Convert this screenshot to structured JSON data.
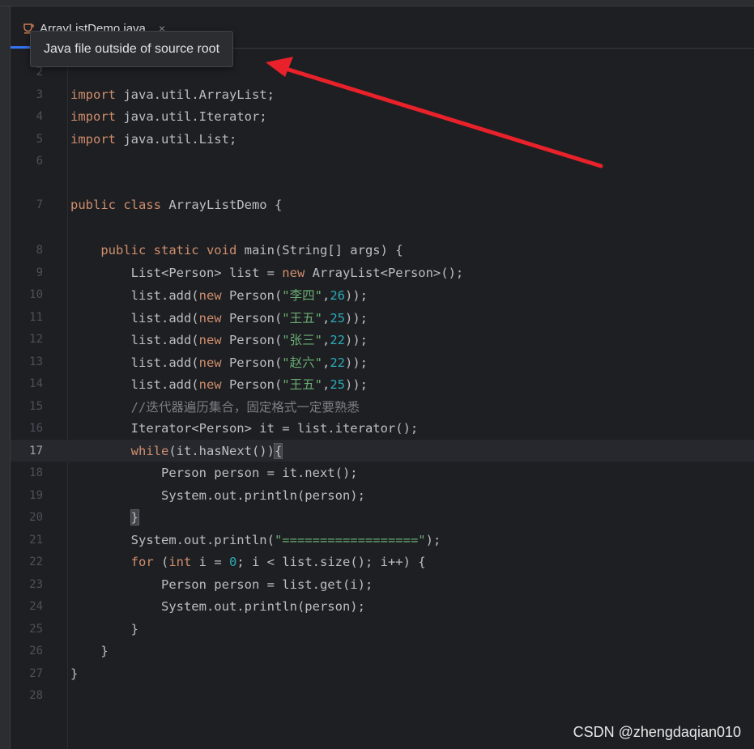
{
  "tab": {
    "filename": "ArrayListDemo.java",
    "close_glyph": "×",
    "icon": "java-file-icon"
  },
  "tooltip": {
    "text": "Java file outside of source root"
  },
  "watermark": {
    "text": "CSDN @zhengdaqian010"
  },
  "colors": {
    "accent": "#3574f0",
    "arrow": "#e8212a",
    "keyword": "#cf8e6d",
    "string": "#6aab73",
    "number": "#2aacb8"
  },
  "current_line": "17",
  "lines": [
    {
      "n": "2",
      "tokens": []
    },
    {
      "n": "3",
      "tokens": [
        [
          "kw",
          "import"
        ],
        [
          "",
          "java.util.ArrayList;"
        ]
      ]
    },
    {
      "n": "4",
      "tokens": [
        [
          "kw",
          "import"
        ],
        [
          "",
          "java.util.Iterator;"
        ]
      ]
    },
    {
      "n": "5",
      "tokens": [
        [
          "kw",
          "import"
        ],
        [
          "",
          "java.util.List;"
        ]
      ]
    },
    {
      "n": "6",
      "tokens": []
    },
    {
      "n": "7",
      "tokens": [
        [
          "kw",
          "public class"
        ],
        [
          "",
          "ArrayListDemo {"
        ]
      ]
    },
    {
      "n": "8",
      "tokens": [
        [
          "",
          "    "
        ],
        [
          "kw",
          "public static void"
        ],
        [
          "",
          "main(String[] args) {"
        ]
      ]
    },
    {
      "n": "9",
      "tokens": [
        [
          "",
          "        List<Person> list = "
        ],
        [
          "kw",
          "new"
        ],
        [
          "",
          " ArrayList<Person>();"
        ]
      ]
    },
    {
      "n": "10",
      "tokens": [
        [
          "",
          "        list.add("
        ],
        [
          "kw",
          "new"
        ],
        [
          "",
          " Person("
        ],
        [
          "str",
          "\"李四\""
        ],
        [
          "",
          ","
        ],
        [
          "num",
          "26"
        ],
        [
          "",
          "));"
        ]
      ]
    },
    {
      "n": "11",
      "tokens": [
        [
          "",
          "        list.add("
        ],
        [
          "kw",
          "new"
        ],
        [
          "",
          " Person("
        ],
        [
          "str",
          "\"王五\""
        ],
        [
          "",
          ","
        ],
        [
          "num",
          "25"
        ],
        [
          "",
          "));"
        ]
      ]
    },
    {
      "n": "12",
      "tokens": [
        [
          "",
          "        list.add("
        ],
        [
          "kw",
          "new"
        ],
        [
          "",
          " Person("
        ],
        [
          "str",
          "\"张三\""
        ],
        [
          "",
          ","
        ],
        [
          "num",
          "22"
        ],
        [
          "",
          "));"
        ]
      ]
    },
    {
      "n": "13",
      "tokens": [
        [
          "",
          "        list.add("
        ],
        [
          "kw",
          "new"
        ],
        [
          "",
          " Person("
        ],
        [
          "str",
          "\"赵六\""
        ],
        [
          "",
          ","
        ],
        [
          "num",
          "22"
        ],
        [
          "",
          "));"
        ]
      ]
    },
    {
      "n": "14",
      "tokens": [
        [
          "",
          "        list.add("
        ],
        [
          "kw",
          "new"
        ],
        [
          "",
          " Person("
        ],
        [
          "str",
          "\"王五\""
        ],
        [
          "",
          ","
        ],
        [
          "num",
          "25"
        ],
        [
          "",
          "));"
        ]
      ]
    },
    {
      "n": "15",
      "tokens": [
        [
          "",
          "        "
        ],
        [
          "cmt",
          "//迭代器遍历集合，固定格式一定要熟悉"
        ]
      ]
    },
    {
      "n": "16",
      "tokens": [
        [
          "",
          "        Iterator<Person> it = list.iterator();"
        ]
      ]
    },
    {
      "n": "17",
      "tokens": [
        [
          "",
          "        "
        ],
        [
          "kw",
          "while"
        ],
        [
          "",
          "(it.hasNext())"
        ],
        [
          "brace-hl",
          "{"
        ]
      ]
    },
    {
      "n": "18",
      "tokens": [
        [
          "",
          "            Person person = it.next();"
        ]
      ]
    },
    {
      "n": "19",
      "tokens": [
        [
          "",
          "            System.out.println(person);"
        ]
      ]
    },
    {
      "n": "20",
      "tokens": [
        [
          "",
          "        "
        ],
        [
          "brace-hl",
          "}"
        ]
      ]
    },
    {
      "n": "21",
      "tokens": [
        [
          "",
          "        System.out.println("
        ],
        [
          "str",
          "\"==================\""
        ],
        [
          "",
          ");"
        ]
      ]
    },
    {
      "n": "22",
      "tokens": [
        [
          "",
          "        "
        ],
        [
          "kw",
          "for"
        ],
        [
          "",
          " ("
        ],
        [
          "kw",
          "int"
        ],
        [
          "",
          " i = "
        ],
        [
          "num",
          "0"
        ],
        [
          "",
          "; i < list.size(); i++) {"
        ]
      ]
    },
    {
      "n": "23",
      "tokens": [
        [
          "",
          "            Person person = list.get(i);"
        ]
      ]
    },
    {
      "n": "24",
      "tokens": [
        [
          "",
          "            System.out.println(person);"
        ]
      ]
    },
    {
      "n": "25",
      "tokens": [
        [
          "",
          "        }"
        ]
      ]
    },
    {
      "n": "26",
      "tokens": [
        [
          "",
          "    }"
        ]
      ]
    },
    {
      "n": "27",
      "tokens": [
        [
          "",
          "}"
        ]
      ]
    },
    {
      "n": "28",
      "tokens": []
    }
  ]
}
